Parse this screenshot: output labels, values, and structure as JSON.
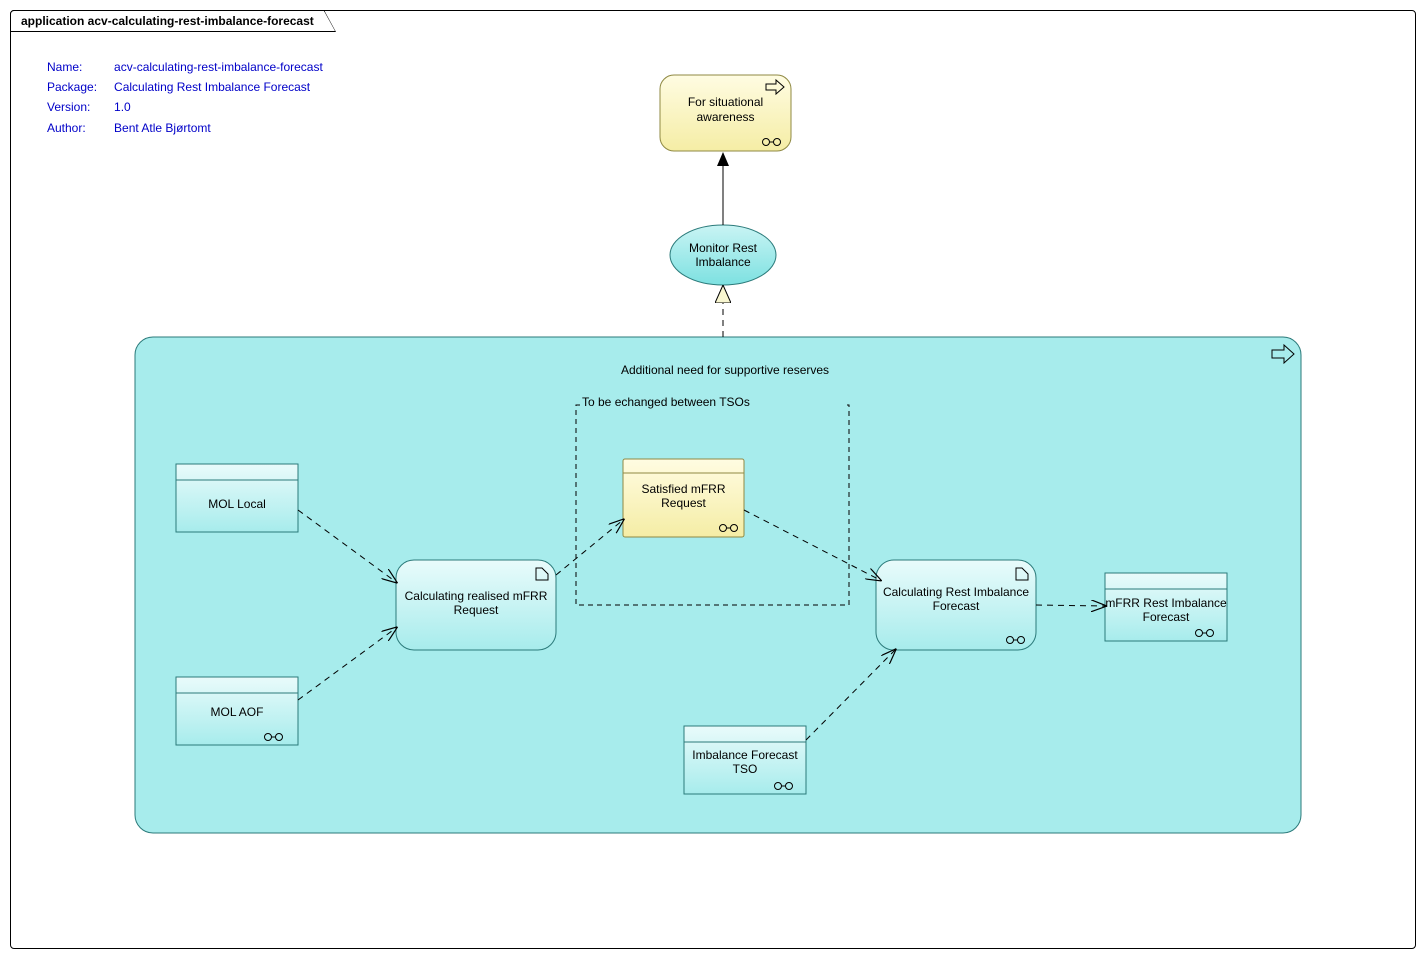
{
  "frame": {
    "title": "application acv-calculating-rest-imbalance-forecast"
  },
  "meta": {
    "name_label": "Name:",
    "name_value": "acv-calculating-rest-imbalance-forecast",
    "pkg_label": "Package:",
    "pkg_value": "Calculating Rest Imbalance Forecast",
    "ver_label": "Version:",
    "ver_value": "1.0",
    "auth_label": "Author:",
    "auth_value": "Bent Atle Bjørtomt"
  },
  "captions": {
    "additional": "Additional need for supportive reserves",
    "tso_box": "To be echanged between TSOs"
  },
  "nodes": {
    "situational": "For situational awareness",
    "monitor": "Monitor Rest Imbalance",
    "mol_local": "MOL Local",
    "mol_aof": "MOL AOF",
    "calc_realised": "Calculating realised mFRR Request",
    "satisfied": "Satisfied mFRR Request",
    "calc_rest": "Calculating Rest Imbalance Forecast",
    "imb_tso": "Imbalance Forecast TSO",
    "mfrr_rest": "mFRR Rest Imbalance Forecast"
  }
}
